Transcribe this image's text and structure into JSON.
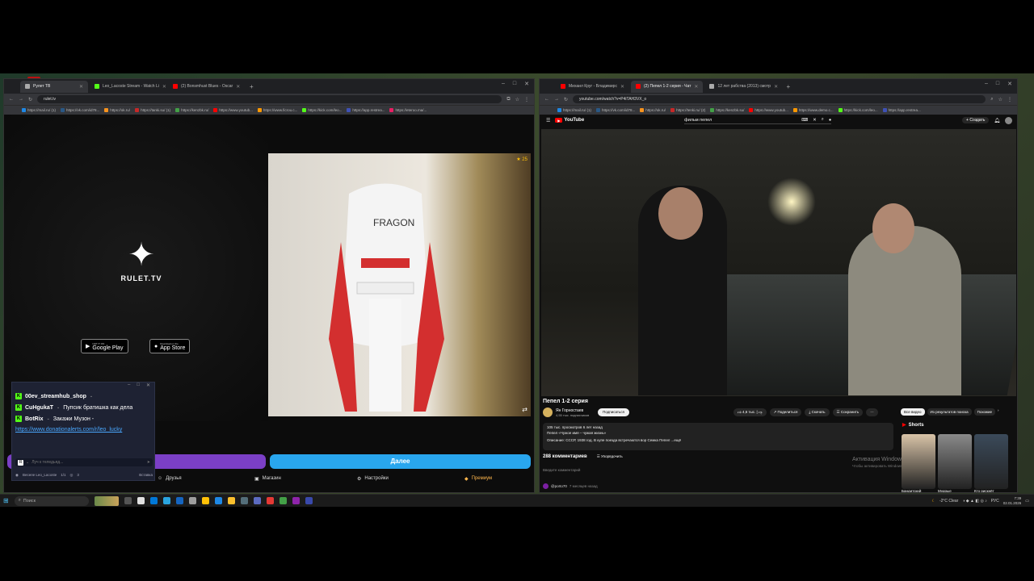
{
  "left_browser": {
    "tabs": [
      {
        "label": "Рулет ТВ",
        "color": "#aaaaaa",
        "active": true
      },
      {
        "label": "Leo_Lacoste Stream - Watch Li",
        "color": "#53fc18",
        "active": false
      },
      {
        "label": "(2) Bonsmhust Blues - Oscar",
        "color": "#ff0000",
        "active": false
      }
    ],
    "url": "rulet.tv",
    "bookmarks": [
      {
        "label": "https://mail.ru/ (1)",
        "color": "#1e88e5"
      },
      {
        "label": "https://vk.com/id78...",
        "color": "#2a5885"
      },
      {
        "label": "https://ok.ru/",
        "color": "#f7931e"
      },
      {
        "label": "https://tanki.su/ (1)",
        "color": "#c62828"
      },
      {
        "label": "https://kenzbk.ru/",
        "color": "#43a047"
      },
      {
        "label": "https://www.youtub...",
        "color": "#ff0000"
      },
      {
        "label": "https://www.ficrou.c...",
        "color": "#ff9800"
      },
      {
        "label": "https://kick.com/leo...",
        "color": "#53fc18"
      },
      {
        "label": "https://app.restrea...",
        "color": "#3f51b5"
      },
      {
        "label": "https://eteroo.ma/...",
        "color": "#e91e63"
      }
    ],
    "page": {
      "logo_text": "RULET.TV",
      "google_play_small": "GET IT ON",
      "google_play": "Google Play",
      "app_store_small": "Download on the",
      "app_store": "App Store",
      "cam_badge": "★ 25",
      "chair_brand": "FRAGON",
      "blue_bar_label": "Далее",
      "nav": {
        "friends": "Друзья",
        "shop": "Магазин",
        "settings": "Настройки",
        "premium": "Премиум"
      }
    }
  },
  "chat": {
    "messages": [
      {
        "user": "00ev_streamhub_shop",
        "text": ""
      },
      {
        "user": "CuHgukaT",
        "text": "Пупсик братишка как дела"
      },
      {
        "user": "BotRix",
        "text": "Закажи Музон -"
      }
    ],
    "link": "https://www.donationalerts.com/r/leo_lucky",
    "input_placeholder": "Луч к теледьяд...",
    "footer_user": "Веселе Leo_Lacoste",
    "footer_count": "1/1",
    "footer_viewers": "3",
    "footer_extra": "Вставка"
  },
  "right_browser": {
    "tabs": [
      {
        "label": "Михаил Круг - Владимирс",
        "color": "#ff0000",
        "active": false
      },
      {
        "label": "(2) Пепел 1-2 серия - Чат",
        "color": "#ff0000",
        "active": true
      },
      {
        "label": "12 лет рабства (2013) смотр",
        "color": "#aaaaaa",
        "active": false
      }
    ],
    "url": "youtube.com/watch?v=P4iTAH3VX_o",
    "bookmarks": [
      {
        "label": "https://mail.ru/ (1)",
        "color": "#1e88e5"
      },
      {
        "label": "https://vk.com/id78...",
        "color": "#2a5885"
      },
      {
        "label": "https://ok.ru/",
        "color": "#f7931e"
      },
      {
        "label": "https://tenki.ru/ (2)",
        "color": "#c62828"
      },
      {
        "label": "https://kenzbk.su/",
        "color": "#43a047"
      },
      {
        "label": "https://www.youtub...",
        "color": "#ff0000"
      },
      {
        "label": "https://www.demo.c...",
        "color": "#ff9800"
      },
      {
        "label": "https://kick.com/leo...",
        "color": "#53fc18"
      },
      {
        "label": "https://app.restrea...",
        "color": "#3f51b5"
      }
    ],
    "youtube": {
      "logo": "YouTube",
      "search_value": "фильм пепел",
      "create_label": "Создать",
      "notifications": "9+",
      "video_title": "Пепел 1-2 серия",
      "channel_name": "Ян Горностаев",
      "channel_subs": "4,55 тыс. подписчиков",
      "subscribe_label": "Подписаться",
      "likes": "4,6 тыс.",
      "share_label": "Поделиться",
      "download_label": "Скачать",
      "save_label": "Сохранить",
      "desc_line1": "105 тыс. просмотров  6 лет назад",
      "desc_line2": "Пепел «Чужое имя – чужая жизнь»",
      "desc_line3": "Описание: СССР, 1938 год. В купе поезда встречаются вор Семка Пепел ...ещё",
      "comments_count": "288 комментариев",
      "sort_label": "Упорядочить",
      "add_comment_placeholder": "Введите комментарий",
      "commenter": "@porto70",
      "commenter_time": "7 месяцев назад",
      "activate_title": "Активация Windows",
      "activate_sub": "Чтобы активировать Windows",
      "chips": [
        "Все видео",
        "Из результатов поиска",
        "Похожие"
      ],
      "shorts_label": "Shorts",
      "shorts": [
        {
          "caption": "Бандитский",
          "color": "#d9c4a8"
        },
        {
          "caption": "Мудрые",
          "color": "#8a8a8a"
        },
        {
          "caption": "Кто рискнёт",
          "color": "#3b4a5a"
        }
      ]
    }
  },
  "taskbar": {
    "search_placeholder": "Поиск",
    "weather": "-2°C  Clear",
    "lang": "РУС",
    "time": "7:39",
    "date": "02.01.2026"
  }
}
